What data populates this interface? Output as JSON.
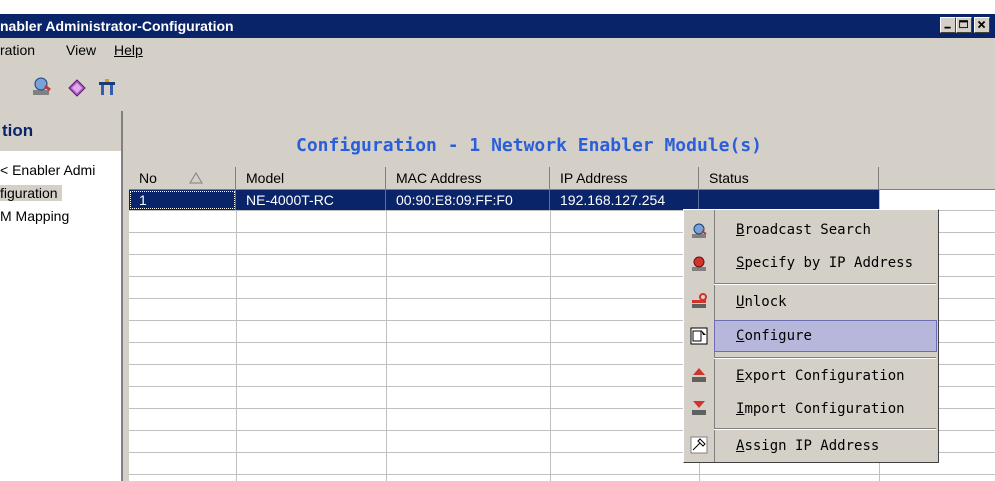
{
  "window": {
    "title": "nabler Administrator-Configuration"
  },
  "menu": {
    "items": [
      "ration",
      "View",
      "Help"
    ]
  },
  "toolbar": {
    "icons": [
      "broadcast-icon",
      "book-icon",
      "signal-icon"
    ]
  },
  "left_pane": {
    "header": "tion",
    "items": [
      "< Enabler Admi",
      "figuration",
      "M Mapping"
    ]
  },
  "right_pane": {
    "header": "Configuration - 1 Network Enabler Module(s)",
    "columns": [
      "No",
      "Model",
      "MAC Address",
      "IP Address",
      "Status"
    ],
    "rows": [
      {
        "no": "1",
        "model": "NE-4000T-RC",
        "mac": "00:90:E8:09:FF:F0",
        "ip": "192.168.127.254",
        "status": ""
      }
    ]
  },
  "context_menu": {
    "items": [
      {
        "label": "Broadcast Search",
        "icon": "broadcast-search-icon"
      },
      {
        "label": "Specify by IP Address",
        "icon": "specify-ip-icon"
      },
      {
        "label": "Unlock",
        "icon": "unlock-icon"
      },
      {
        "label": "Configure",
        "icon": "configure-icon"
      },
      {
        "label": "Export Configuration",
        "icon": "export-icon"
      },
      {
        "label": "Import Configuration",
        "icon": "import-icon"
      },
      {
        "label": "Assign IP Address",
        "icon": "assign-ip-icon"
      }
    ],
    "highlighted": "Configure"
  }
}
